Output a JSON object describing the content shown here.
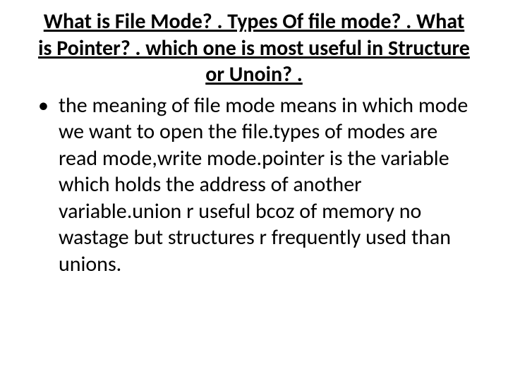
{
  "title": "What is File Mode? . Types Of file mode? . What is Pointer? . which one is most useful in Structure or Unoin? .",
  "bullet": "•",
  "body": "the meaning of file mode means in which mode we want to open the file.types of modes are read mode,write mode.pointer is the variable which holds the address of another variable.union r useful bcoz of memory no wastage but structures r frequently used than unions."
}
